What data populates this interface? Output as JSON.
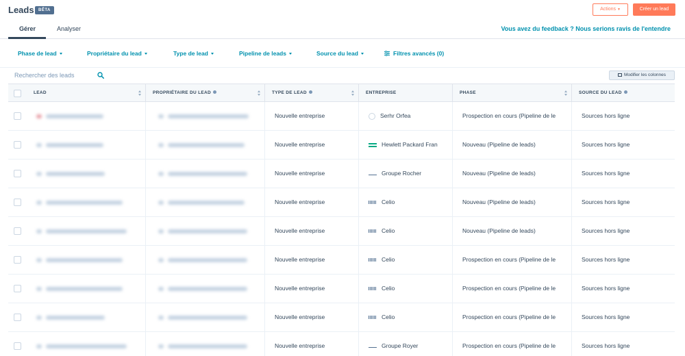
{
  "header": {
    "title": "Leads",
    "badge": "BÊTA",
    "actions_label": "Actions",
    "create_label": "Créer un lead"
  },
  "tabs": [
    {
      "label": "Gérer",
      "active": true
    },
    {
      "label": "Analyser",
      "active": false
    }
  ],
  "feedback_link": "Vous avez du feedback ? Nous serions ravis de l'entendre",
  "filters": [
    {
      "label": "Phase de lead"
    },
    {
      "label": "Propriétaire du lead"
    },
    {
      "label": "Type de lead"
    },
    {
      "label": "Pipeline de leads"
    },
    {
      "label": "Source du lead"
    },
    {
      "label": "Filtres avancés (0)"
    }
  ],
  "search": {
    "placeholder": "Rechercher des leads"
  },
  "modify_columns_label": "Modifier les colonnes",
  "table": {
    "columns": [
      "LEAD",
      "PROPRIÉTAIRE DU LEAD",
      "TYPE DE LEAD",
      "ENTREPRISE",
      "PHASE",
      "SOURCE DU LEAD"
    ],
    "rows": [
      {
        "type": "Nouvelle entreprise",
        "company": "Serhr Orfea",
        "phase": "Prospection en cours (Pipeline de le",
        "source": "Sources hors ligne"
      },
      {
        "type": "Nouvelle entreprise",
        "company": "Hewlett Packard Fran",
        "phase": "Nouveau (Pipeline de leads)",
        "source": "Sources hors ligne"
      },
      {
        "type": "Nouvelle entreprise",
        "company": "Groupe Rocher",
        "phase": "Nouveau (Pipeline de leads)",
        "source": "Sources hors ligne"
      },
      {
        "type": "Nouvelle entreprise",
        "company": "Celio",
        "phase": "Nouveau (Pipeline de leads)",
        "source": "Sources hors ligne"
      },
      {
        "type": "Nouvelle entreprise",
        "company": "Celio",
        "phase": "Nouveau (Pipeline de leads)",
        "source": "Sources hors ligne"
      },
      {
        "type": "Nouvelle entreprise",
        "company": "Celio",
        "phase": "Prospection en cours (Pipeline de le",
        "source": "Sources hors ligne"
      },
      {
        "type": "Nouvelle entreprise",
        "company": "Celio",
        "phase": "Prospection en cours (Pipeline de le",
        "source": "Sources hors ligne"
      },
      {
        "type": "Nouvelle entreprise",
        "company": "Celio",
        "phase": "Prospection en cours (Pipeline de le",
        "source": "Sources hors ligne"
      },
      {
        "type": "Nouvelle entreprise",
        "company": "Groupe Royer",
        "phase": "Prospection en cours (Pipeline de le",
        "source": "Sources hors ligne"
      }
    ]
  },
  "colors": {
    "accent": "#ff7a59",
    "link": "#0091ae",
    "text": "#33475b",
    "header_bg": "#f5f8fa"
  }
}
